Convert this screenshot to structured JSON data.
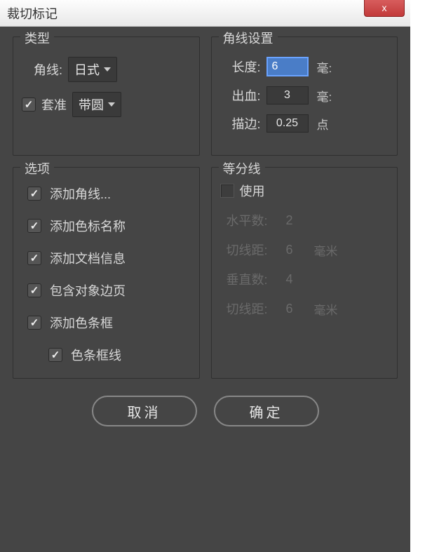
{
  "window": {
    "title": "裁切标记",
    "close_label": "x"
  },
  "type_group": {
    "legend": "类型",
    "corner_label": "角线:",
    "corner_value": "日式",
    "reg_label": "套准",
    "reg_checked": true,
    "reg_value": "带圆"
  },
  "corner_settings": {
    "legend": "角线设置",
    "length_label": "长度:",
    "length_value": "6",
    "length_unit": "毫:",
    "bleed_label": "出血:",
    "bleed_value": "3",
    "bleed_unit": "毫:",
    "stroke_label": "描边:",
    "stroke_value": "0.25",
    "stroke_unit": "点"
  },
  "options": {
    "legend": "选项",
    "items": [
      "添加角线...",
      "添加色标名称",
      "添加文档信息",
      "包含对象边页",
      "添加色条框",
      "色条框线"
    ]
  },
  "divider": {
    "legend": "等分线",
    "use_label": "使用",
    "rows": [
      {
        "label": "水平数:",
        "value": "2",
        "unit": ""
      },
      {
        "label": "切线距:",
        "value": "6",
        "unit": "毫米"
      },
      {
        "label": "垂直数:",
        "value": "4",
        "unit": ""
      },
      {
        "label": "切线距:",
        "value": "6",
        "unit": "毫米"
      }
    ]
  },
  "buttons": {
    "cancel": "取消",
    "ok": "确定"
  }
}
